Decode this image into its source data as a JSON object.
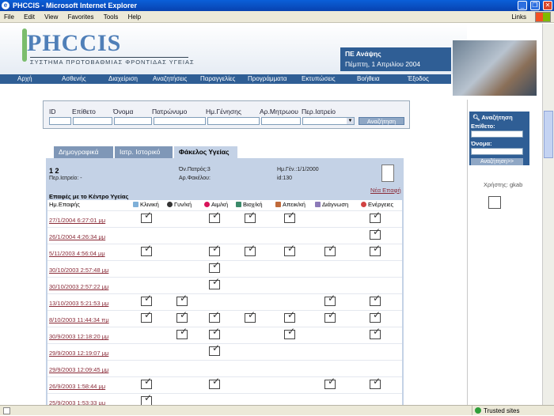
{
  "window": {
    "title": "PHCCIS - Microsoft Internet Explorer"
  },
  "menu": {
    "items": [
      "File",
      "Edit",
      "View",
      "Favorites",
      "Tools",
      "Help"
    ],
    "links": "Links"
  },
  "header": {
    "logo": "PHCCIS",
    "subtitle": "ΣΥΣΤΗΜΑ ΠΡΩΤΟΒΑΘΜΙΑΣ ΦΡΟΝΤΙΔΑΣ ΥΓΕΙΑΣ",
    "title": "ΠΕ Ανάψης",
    "date": "Πέμπτη, 1 Απριλίου 2004"
  },
  "nav": {
    "items": [
      "Αρχή",
      "Ασθενής",
      "Διαχείριση",
      "Αναζητήσεις",
      "Παραγγελίες",
      "Προγράμματα",
      "Εκτυπώσεις",
      "Βοήθεια",
      "Έξοδος"
    ]
  },
  "search": {
    "labels": [
      "ID",
      "Επίθετο",
      "Όνομα",
      "Πατρώνυμο",
      "Ημ.Γένησης",
      "Αρ.Μητρωου",
      "Περ.Ιατρείο"
    ],
    "button": "Αναζήτηση"
  },
  "tabs": [
    "Δημογραφικά",
    "Ιατρ. Ιστορικό",
    "Φάκελος Υγείας"
  ],
  "patient": {
    "name": "1 2",
    "father": "Όν.Πατρός:3",
    "birth": "Ημ.Γέν.:1/1/2000",
    "clinic": "Περ.Ιατρείο: -",
    "file": "Αρ.Φακέλου:",
    "id": "id:130"
  },
  "new_contact": "Νέα Επαφή",
  "contacts": {
    "title": "Επαφές με το Κέντρο Υγείας",
    "headers": [
      "Ημ.Επαφής",
      "Κλινική",
      "Γυν/κή",
      "Αιμ/κή",
      "Βιοχ/κή",
      "Απεικ/κή",
      "Διάγνωση",
      "Ενέργειες"
    ],
    "rows": [
      {
        "date": "27/1/2004 6:27:01 μμ",
        "cols": [
          1,
          0,
          1,
          1,
          1,
          0,
          1
        ]
      },
      {
        "date": "26/1/2004 4:26:34 μμ",
        "cols": [
          0,
          0,
          0,
          0,
          0,
          0,
          1
        ]
      },
      {
        "date": "5/11/2003 4:56:04 μμ",
        "cols": [
          1,
          0,
          1,
          1,
          1,
          1,
          1
        ]
      },
      {
        "date": "30/10/2003 2:57:48 μμ",
        "cols": [
          0,
          0,
          1,
          0,
          0,
          0,
          0
        ]
      },
      {
        "date": "30/10/2003 2:57:22 μμ",
        "cols": [
          0,
          0,
          1,
          0,
          0,
          0,
          0
        ]
      },
      {
        "date": "13/10/2003 5:21:53 μμ",
        "cols": [
          1,
          1,
          0,
          0,
          0,
          1,
          1
        ]
      },
      {
        "date": "8/10/2003 11:44:34 πμ",
        "cols": [
          1,
          1,
          1,
          1,
          1,
          1,
          1
        ]
      },
      {
        "date": "30/9/2003 12:18:20 μμ",
        "cols": [
          0,
          1,
          1,
          0,
          1,
          0,
          1
        ]
      },
      {
        "date": "29/9/2003 12:19:07 μμ",
        "cols": [
          0,
          0,
          1,
          0,
          0,
          0,
          0
        ]
      },
      {
        "date": "29/9/2003 12:09:45 μμ",
        "cols": [
          0,
          0,
          0,
          0,
          0,
          0,
          0
        ]
      },
      {
        "date": "26/9/2003 1:58:44 μμ",
        "cols": [
          1,
          0,
          1,
          0,
          0,
          1,
          1
        ]
      },
      {
        "date": "25/9/2003 1:53:33 μμ",
        "cols": [
          1,
          0,
          0,
          0,
          0,
          0,
          0
        ]
      }
    ]
  },
  "sidebar": {
    "title": "Αναζήτηση",
    "surname": "Επίθετο:",
    "name": "Όνομα:",
    "button": "Αναζήτηση>>",
    "user": "Χρήστης: gkab"
  },
  "status": {
    "zone": "Trusted sites"
  }
}
